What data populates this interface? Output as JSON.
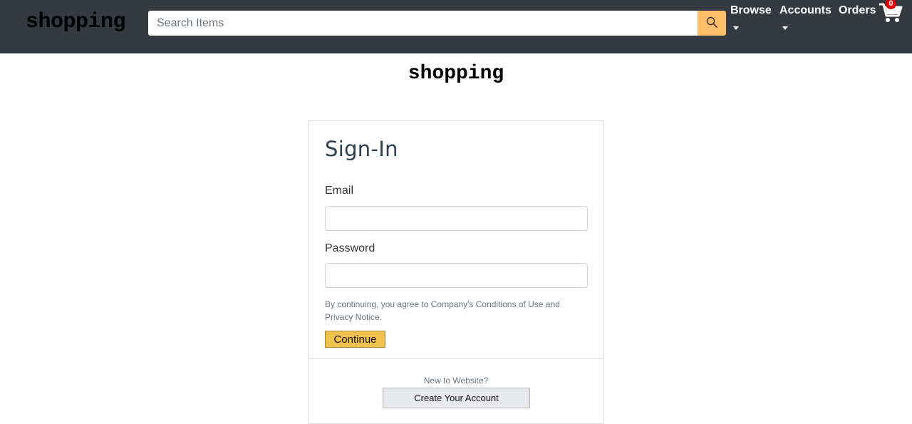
{
  "header": {
    "logo": "shopping",
    "search": {
      "placeholder": "Search Items",
      "value": ""
    },
    "search_button_icon": "search-icon",
    "nav": [
      {
        "label": "Browse",
        "has_dropdown": true
      },
      {
        "label": "Accounts",
        "has_dropdown": true
      },
      {
        "label": "Orders",
        "has_dropdown": false
      }
    ],
    "cart": {
      "icon": "cart-icon",
      "count": "0"
    },
    "colors": {
      "bar": "#343a40",
      "search_button": "#febd69",
      "badge": "#e00000"
    }
  },
  "main": {
    "logo": "shopping",
    "signin": {
      "title": "Sign-In",
      "email_label": "Email",
      "email_value": "",
      "password_label": "Password",
      "password_value": "",
      "legal_text": "By continuing, you agree to Company's Conditions of Use and Privacy Notice.",
      "continue_label": "Continue",
      "new_text": "New to Website?",
      "create_label": "Create Your Account"
    },
    "colors": {
      "continue_button": "#f0c14b",
      "create_button": "#e7e9ec"
    }
  }
}
